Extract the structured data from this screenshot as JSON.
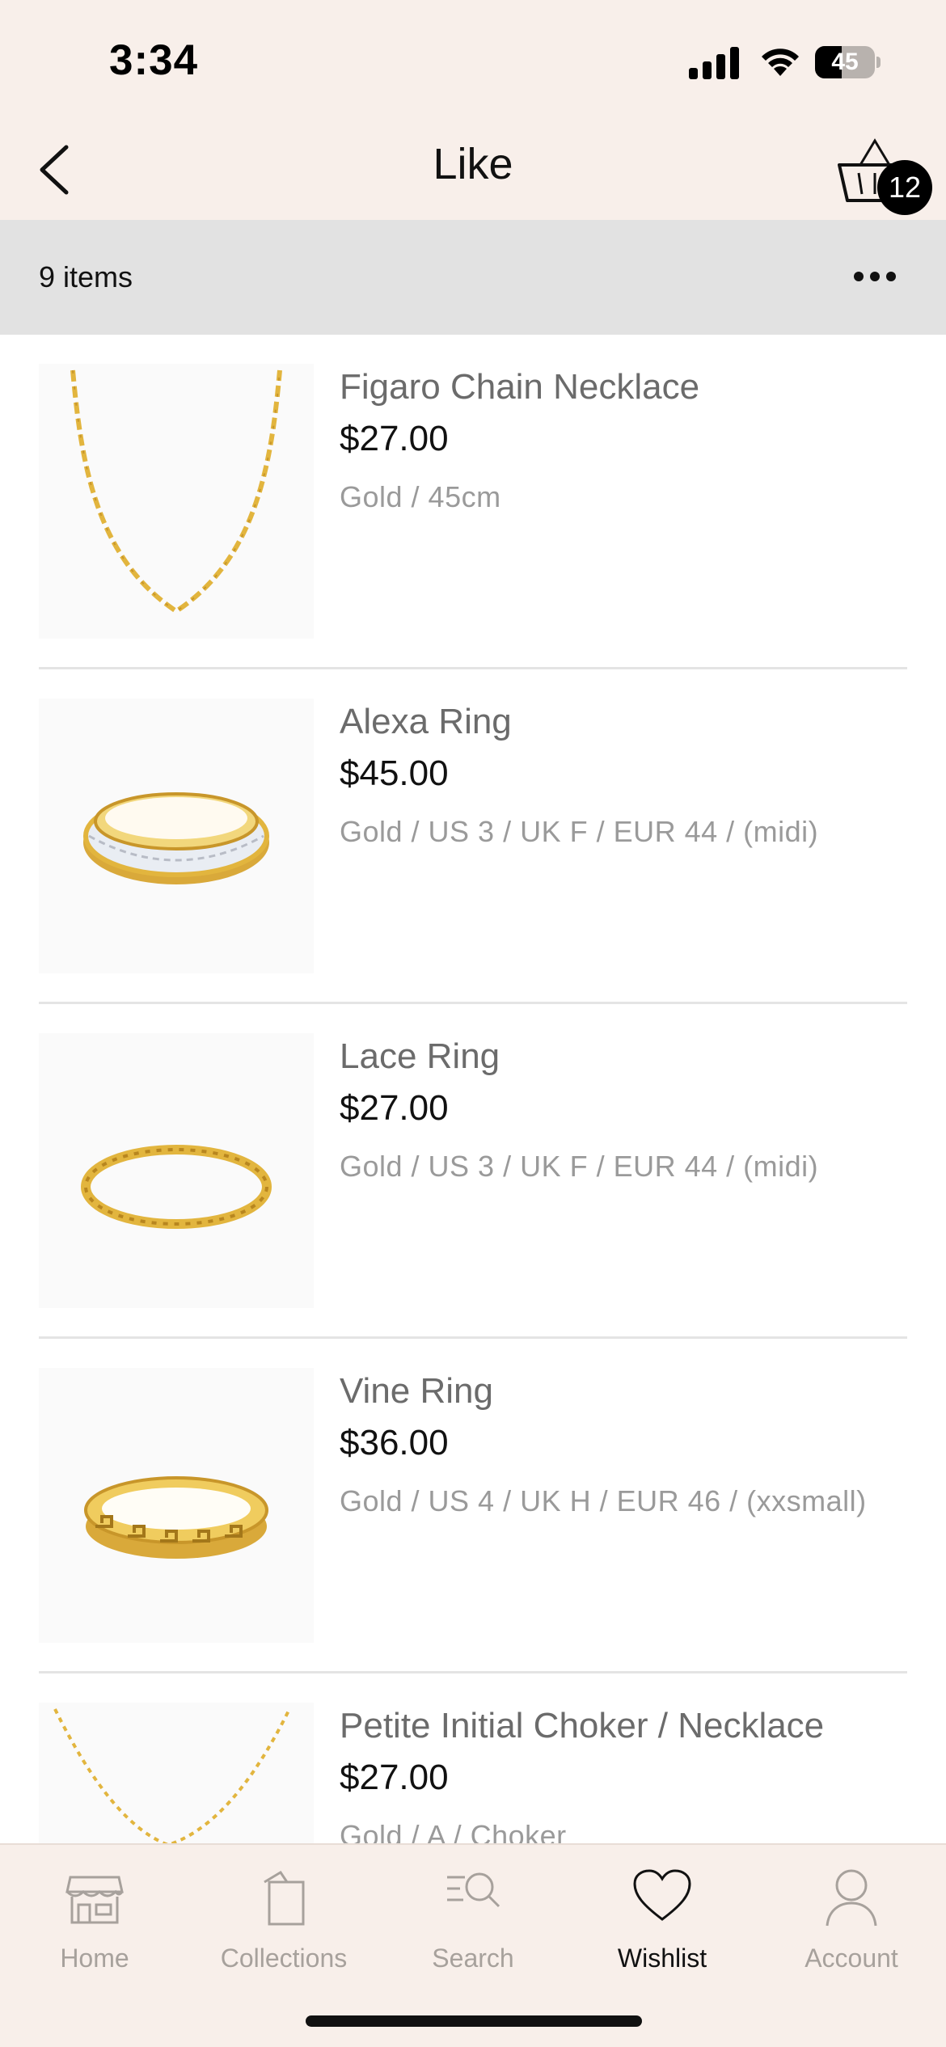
{
  "status_bar": {
    "time": "3:34",
    "battery": "45",
    "battery_level": 0.45
  },
  "nav": {
    "title": "Like",
    "cart_count": "12"
  },
  "list_header": {
    "items_count": "9 items"
  },
  "products": [
    {
      "name": "Figaro Chain Necklace",
      "price": "$27.00",
      "variant": "Gold / 45cm",
      "image": "figaro-chain-necklace"
    },
    {
      "name": "Alexa Ring",
      "price": "$45.00",
      "variant": "Gold / US 3 / UK F / EUR 44 / (midi)",
      "image": "alexa-ring"
    },
    {
      "name": "Lace Ring",
      "price": "$27.00",
      "variant": "Gold / US 3 / UK F / EUR 44 / (midi)",
      "image": "lace-ring"
    },
    {
      "name": "Vine Ring",
      "price": "$36.00",
      "variant": "Gold / US 4 / UK H / EUR 46 / (xxsmall)",
      "image": "vine-ring"
    },
    {
      "name": "Petite Initial Choker / Necklace",
      "price": "$27.00",
      "variant": "Gold / A / Choker",
      "image": "petite-initial-choker"
    }
  ],
  "tabs": [
    {
      "label": "Home",
      "icon": "store-icon",
      "active": false
    },
    {
      "label": "Collections",
      "icon": "collections-icon",
      "active": false
    },
    {
      "label": "Search",
      "icon": "search-icon",
      "active": false
    },
    {
      "label": "Wishlist",
      "icon": "heart-icon",
      "active": true
    },
    {
      "label": "Account",
      "icon": "person-icon",
      "active": false
    }
  ],
  "colors": {
    "header_bg": "#f8efea",
    "items_bar_bg": "#e2e2e2",
    "gold": "#e2b53e",
    "active_tab": "#111111",
    "inactive_tab": "#a7a19c"
  }
}
